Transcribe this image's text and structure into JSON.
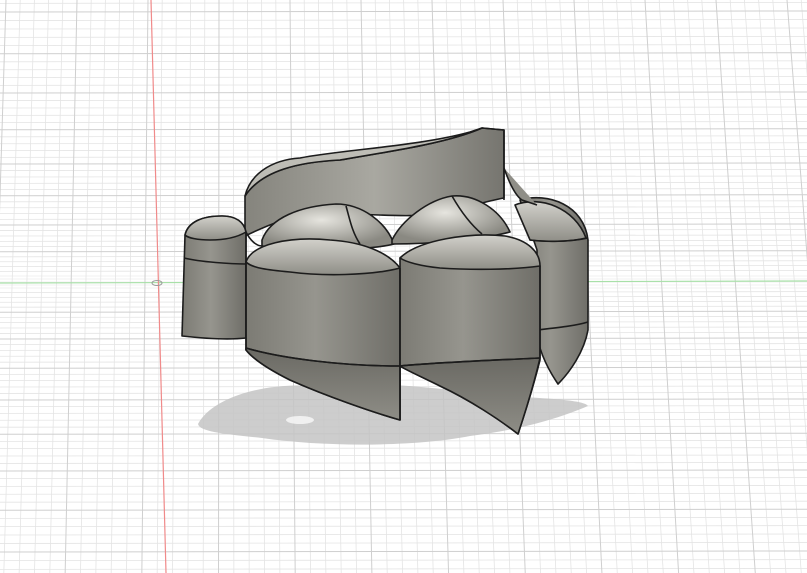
{
  "viewport": {
    "kind": "3D CAD modeling viewport",
    "background": "#ffffff",
    "grid": {
      "visible": true,
      "minor_color": "#e4e4e4",
      "major_color": "#cfcfcf"
    },
    "axes": {
      "vertical_axis_color": "#f08a8a",
      "horizontal_axis_color": "#a8e0a8"
    },
    "model": {
      "kind": "multi-lobed rotor / impeller solid",
      "lobe_count": 4,
      "base_color": "#8c8b84",
      "edge_color": "#1c1c1c",
      "highlight_color": "#d9d8d2",
      "shadow_color": "#bdbdbd"
    },
    "origin_marker": {
      "icon": "axis-origin-icon"
    }
  }
}
